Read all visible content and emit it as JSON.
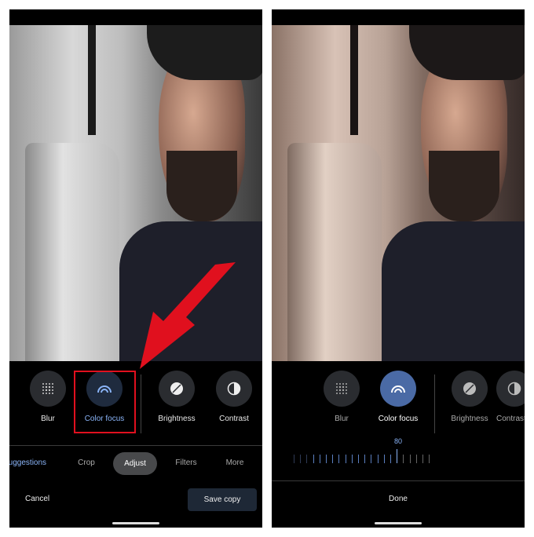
{
  "left": {
    "tools": [
      {
        "label": "Blur",
        "icon": "blur-icon"
      },
      {
        "label": "Color focus",
        "icon": "color-focus-icon",
        "active": true
      },
      {
        "label": "Brightness",
        "icon": "brightness-icon"
      },
      {
        "label": "Contrast",
        "icon": "contrast-icon"
      }
    ],
    "tabs": [
      {
        "label": "Suggestions",
        "active_color": "#8ab4f8"
      },
      {
        "label": "Crop"
      },
      {
        "label": "Adjust",
        "selected": true
      },
      {
        "label": "Filters"
      },
      {
        "label": "More"
      }
    ],
    "cancel": "Cancel",
    "save_copy": "Save copy",
    "highlight_color": "#e0101e"
  },
  "right": {
    "tools": [
      {
        "label": "Blur",
        "icon": "blur-icon"
      },
      {
        "label": "Color focus",
        "icon": "color-focus-icon",
        "active": true
      },
      {
        "label": "Brightness",
        "icon": "brightness-icon"
      },
      {
        "label": "Contrast",
        "icon": "contrast-icon"
      }
    ],
    "slider": {
      "value": "80",
      "percent": 80
    },
    "done": "Done",
    "accent": "#4a6aa5"
  }
}
